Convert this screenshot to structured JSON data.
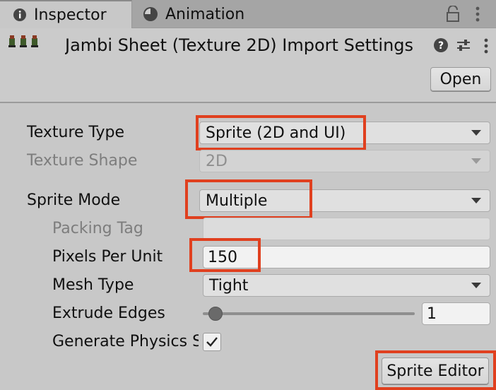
{
  "tabs": [
    {
      "label": "Inspector",
      "icon": "info-icon"
    },
    {
      "label": "Animation",
      "icon": "clock-icon"
    }
  ],
  "header": {
    "title": "Jambi Sheet (Texture 2D) Import Settings",
    "open_label": "Open"
  },
  "form": {
    "texture_type": {
      "label": "Texture Type",
      "value": "Sprite (2D and UI)"
    },
    "texture_shape": {
      "label": "Texture Shape",
      "value": "2D"
    },
    "sprite_mode": {
      "label": "Sprite Mode",
      "value": "Multiple"
    },
    "packing_tag": {
      "label": "Packing Tag",
      "value": ""
    },
    "pixels_per_unit": {
      "label": "Pixels Per Unit",
      "value": "150"
    },
    "mesh_type": {
      "label": "Mesh Type",
      "value": "Tight"
    },
    "extrude_edges": {
      "label": "Extrude Edges",
      "value": "1",
      "slider_fraction": 0.06
    },
    "generate_physics": {
      "label": "Generate Physics Shape",
      "checked": true
    }
  },
  "sprite_editor_label": "Sprite Editor",
  "colors": {
    "highlight": "#e0401f",
    "panel": "#c8c8c8"
  }
}
